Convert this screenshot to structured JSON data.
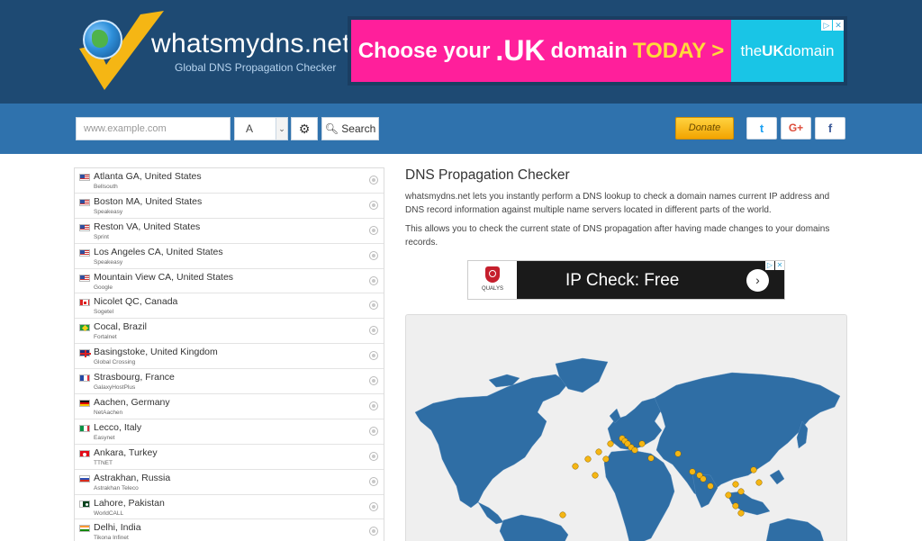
{
  "header": {
    "site_title": "whatsmydns.net",
    "tagline": "Global DNS Propagation Checker"
  },
  "top_ad": {
    "text_choose": "Choose your",
    "text_uk": ".UK",
    "text_domain": "domain",
    "text_today": "TODAY",
    "text_arrow": ">",
    "brand_the": "the",
    "brand_uk": "UK",
    "brand_domain": "domain",
    "colors": {
      "main": "#ff1f9b",
      "side": "#19c5e6",
      "highlight": "#ffd93b"
    }
  },
  "search": {
    "placeholder": "www.example.com",
    "record_type": "A",
    "search_label": "Search",
    "donate_label": "Donate"
  },
  "social": {
    "twitter": "t",
    "googleplus": "G+",
    "facebook": "f"
  },
  "locations": [
    {
      "city": "Atlanta GA, United States",
      "isp": "Bellsouth",
      "flag": "us"
    },
    {
      "city": "Boston MA, United States",
      "isp": "Speakeasy",
      "flag": "us"
    },
    {
      "city": "Reston VA, United States",
      "isp": "Sprint",
      "flag": "us"
    },
    {
      "city": "Los Angeles CA, United States",
      "isp": "Speakeasy",
      "flag": "us"
    },
    {
      "city": "Mountain View CA, United States",
      "isp": "Google",
      "flag": "us"
    },
    {
      "city": "Nicolet QC, Canada",
      "isp": "Sogetel",
      "flag": "ca"
    },
    {
      "city": "Cocal, Brazil",
      "isp": "Fortalnet",
      "flag": "br"
    },
    {
      "city": "Basingstoke, United Kingdom",
      "isp": "Global Crossing",
      "flag": "gb"
    },
    {
      "city": "Strasbourg, France",
      "isp": "GalaxyHostPlus",
      "flag": "fr"
    },
    {
      "city": "Aachen, Germany",
      "isp": "NetAachen",
      "flag": "de"
    },
    {
      "city": "Lecco, Italy",
      "isp": "Easynet",
      "flag": "it"
    },
    {
      "city": "Ankara, Turkey",
      "isp": "TTNET",
      "flag": "tr"
    },
    {
      "city": "Astrakhan, Russia",
      "isp": "Astrakhan Teleco",
      "flag": "ru"
    },
    {
      "city": "Lahore, Pakistan",
      "isp": "WorldCALL",
      "flag": "pk"
    },
    {
      "city": "Delhi, India",
      "isp": "Tikona Infinet",
      "flag": "in"
    }
  ],
  "content": {
    "title": "DNS Propagation Checker",
    "paragraph1": "whatsmydns.net lets you instantly perform a DNS lookup to check a domain names current IP address and DNS record information against multiple name servers located in different parts of the world.",
    "paragraph2": "This allows you to check the current state of DNS propagation after having made changes to your domains records."
  },
  "mid_ad": {
    "brand": "QUALYS",
    "text": "IP Check: Free",
    "go": "›"
  },
  "map": {
    "land_color": "#2f6ea5",
    "marker_color": "#f5b614"
  }
}
